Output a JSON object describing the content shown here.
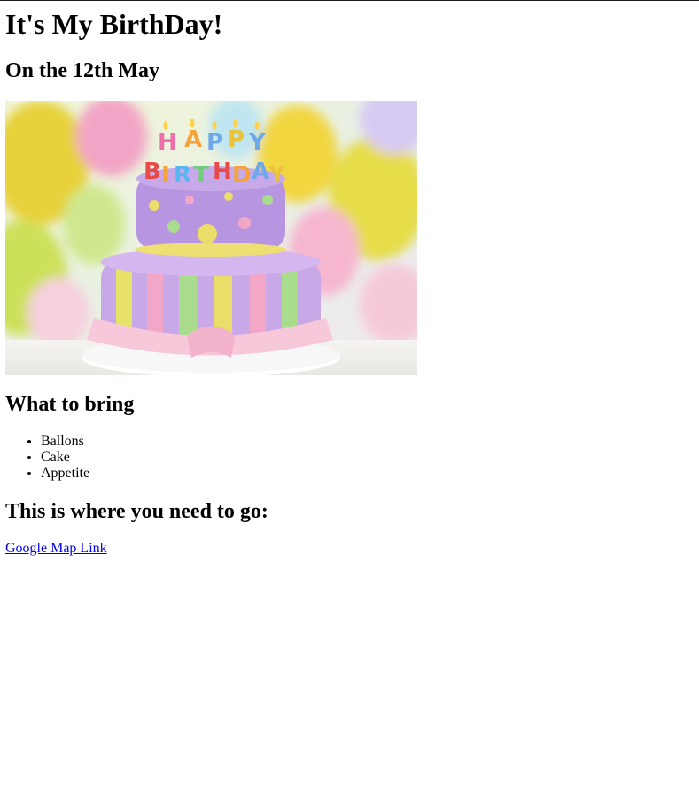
{
  "page": {
    "title": "It's My BirthDay!",
    "date_heading": "On the 12th May",
    "image": {
      "alt": "Birthday cake",
      "candle_letters_top": [
        "H",
        "A",
        "P",
        "P",
        "Y"
      ],
      "candle_letters_bottom": [
        "B",
        "I",
        "R",
        "T",
        "H",
        "D",
        "A",
        "Y"
      ]
    },
    "bring_heading": "What to bring",
    "bring_items": [
      "Ballons",
      "Cake",
      "Appetite"
    ],
    "where_heading": "This is where you need to go:",
    "map_link_text": "Google Map Link"
  },
  "colors": {
    "link": "#0000ee",
    "text": "#000000",
    "background": "#ffffff"
  }
}
